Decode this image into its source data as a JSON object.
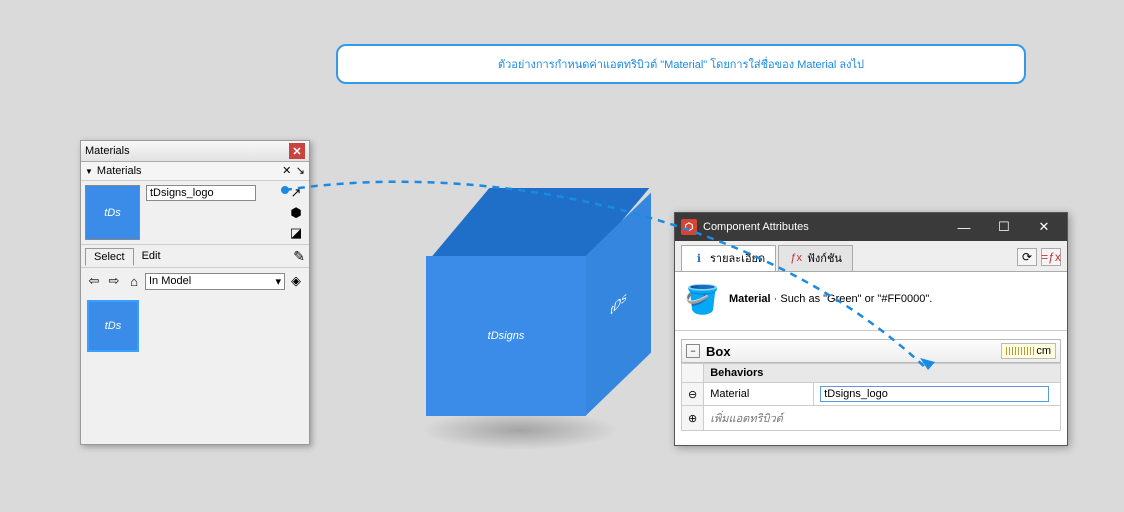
{
  "annotation": "ตัวอย่างการกำหนดค่าแอตทริบิวต์ \"Material\" โดยการใส่ชื่อของ Material ลงไป",
  "materials": {
    "panel_title": "Materials",
    "section_title": "Materials",
    "current_name": "tDsigns_logo",
    "tabs": {
      "select": "Select",
      "edit": "Edit"
    },
    "dropdown": "In Model",
    "swatch_text": "tDs"
  },
  "cube": {
    "front": "tDsigns",
    "side": "tDs"
  },
  "comp": {
    "window_title": "Component Attributes",
    "tabs": {
      "details": "รายละเอียด",
      "functions": "ฟังก์ชัน"
    },
    "hint_label": "Material",
    "hint_text": " · Such as \"Green\" or \"#FF0000\".",
    "component_name": "Box",
    "unit": "cm",
    "section": "Behaviors",
    "attr_name": "Material",
    "attr_value": "tDsigns_logo",
    "add_attribute": "เพิ่มแอตทริบิวต์"
  }
}
